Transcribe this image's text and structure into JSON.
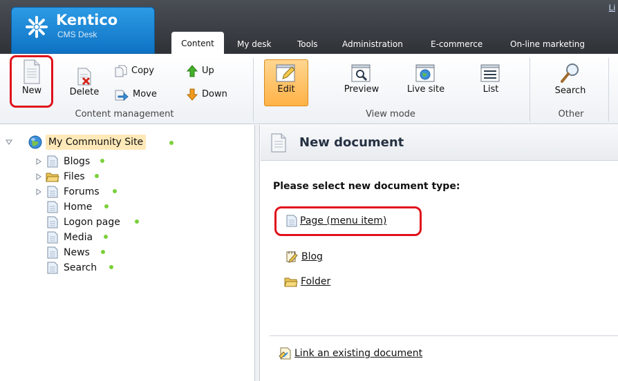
{
  "app": {
    "logo_name": "Kentico",
    "logo_subtitle": "CMS Desk",
    "corner_link": "Li",
    "brand_color": "#1f86d6"
  },
  "tabs": [
    {
      "label": "Content",
      "active": true
    },
    {
      "label": "My desk"
    },
    {
      "label": "Tools"
    },
    {
      "label": "Administration"
    },
    {
      "label": "E-commerce"
    },
    {
      "label": "On-line marketing"
    }
  ],
  "toolbar": {
    "content_management": {
      "caption": "Content management",
      "new_label": "New",
      "delete_label": "Delete",
      "copy_label": "Copy",
      "move_label": "Move",
      "up_label": "Up",
      "down_label": "Down"
    },
    "view_mode": {
      "caption": "View mode",
      "edit_label": "Edit",
      "preview_label": "Preview",
      "live_site_label": "Live site",
      "list_label": "List",
      "selected": "Edit"
    },
    "other": {
      "caption": "Other",
      "search_label": "Search"
    }
  },
  "tree": {
    "root": {
      "label": "My Community Site",
      "icon": "globe-icon",
      "published": true
    },
    "items": [
      {
        "label": "Blogs",
        "icon": "page-icon",
        "expandable": true,
        "published": true
      },
      {
        "label": "Files",
        "icon": "folder-icon",
        "expandable": true,
        "published": true
      },
      {
        "label": "Forums",
        "icon": "page-icon",
        "expandable": true,
        "published": true
      },
      {
        "label": "Home",
        "icon": "page-icon",
        "expandable": false,
        "published": true
      },
      {
        "label": "Logon page",
        "icon": "page-icon",
        "expandable": false,
        "published": true
      },
      {
        "label": "Media",
        "icon": "page-icon",
        "expandable": false,
        "published": true
      },
      {
        "label": "News",
        "icon": "page-icon",
        "expandable": false,
        "published": true
      },
      {
        "label": "Search",
        "icon": "page-icon",
        "expandable": false,
        "published": true
      }
    ],
    "status_color": "#7ad03a"
  },
  "main": {
    "title": "New document",
    "prompt": "Please select new document type:",
    "document_types": [
      {
        "label": "Page (menu item)",
        "icon": "page-icon"
      },
      {
        "label": "Blog",
        "icon": "blog-icon"
      },
      {
        "label": "Folder",
        "icon": "folder-icon"
      }
    ],
    "link_existing": "Link an existing document",
    "highlight_color": "#e0101a"
  }
}
